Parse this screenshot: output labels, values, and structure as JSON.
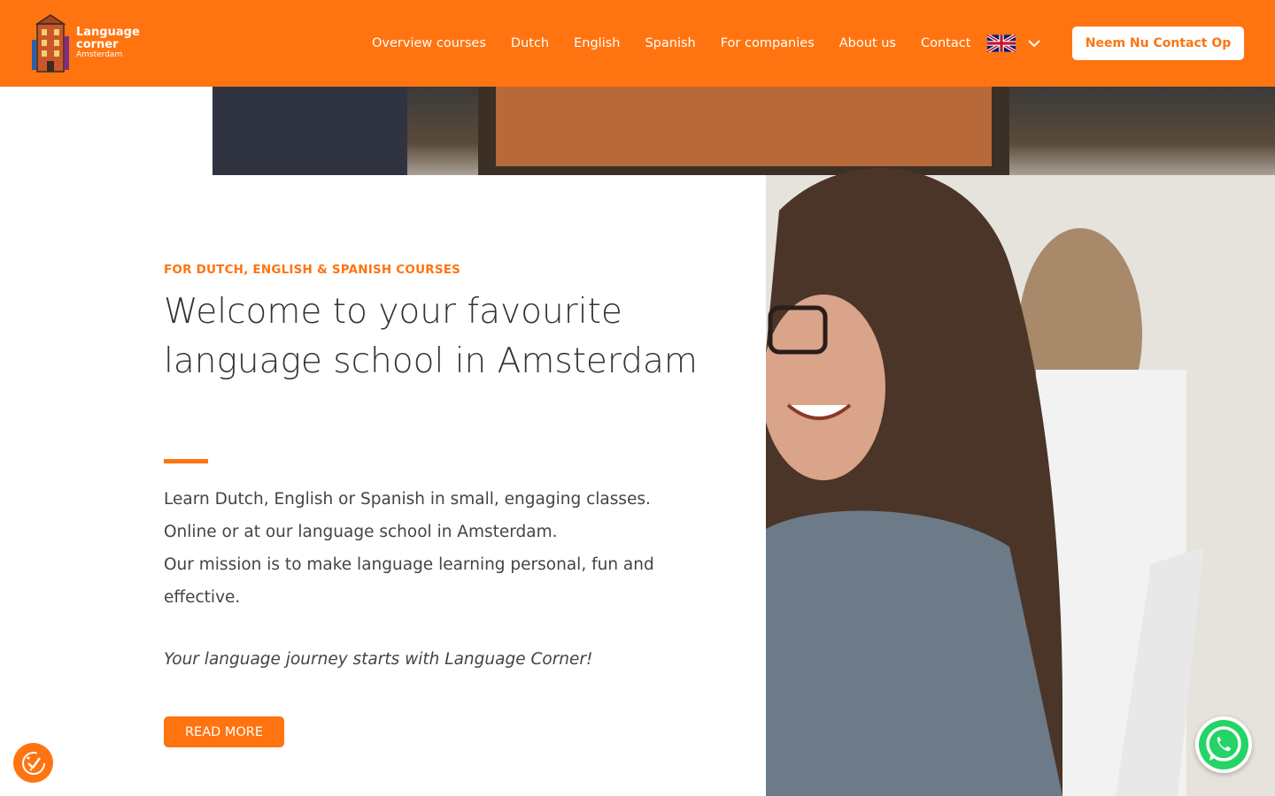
{
  "brand": {
    "logo_line1": "Language",
    "logo_line2": "corner",
    "logo_line3": "Amsterdam"
  },
  "nav": {
    "items": [
      {
        "label": "Overview courses"
      },
      {
        "label": "Dutch"
      },
      {
        "label": "English"
      },
      {
        "label": "Spanish"
      },
      {
        "label": "For companies"
      },
      {
        "label": "About us"
      },
      {
        "label": "Contact"
      }
    ],
    "language_icon": "uk-flag-icon",
    "cta_label": "Neem Nu Contact Op"
  },
  "hero": {
    "eyebrow": "FOR DUTCH, ENGLISH & SPANISH COURSES",
    "headline": "Welcome to your favourite language school in Amsterdam",
    "body_line1": "Learn Dutch, English or Spanish in small, engaging classes.",
    "body_line2": "Online or at our language school in Amsterdam.",
    "body_line3": "Our mission is to make language learning personal, fun and effective.",
    "tagline": "Your language journey starts with Language Corner!",
    "button_label": "READ MORE"
  },
  "widgets": {
    "cookie_icon": "cookie-consent-icon",
    "whatsapp_icon": "whatsapp-icon"
  },
  "colors": {
    "accent": "#ff7410",
    "text": "#333333"
  }
}
